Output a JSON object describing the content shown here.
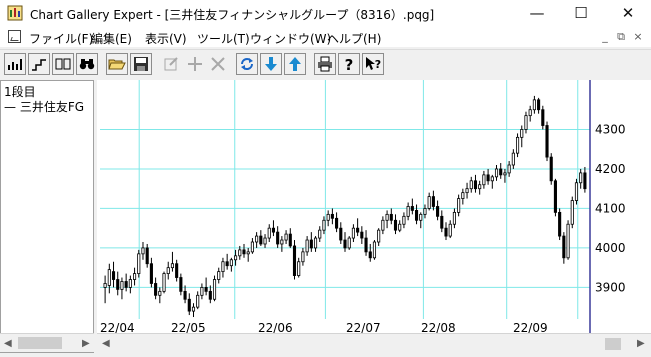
{
  "window": {
    "title": "Chart Gallery Expert - [三井住友フィナンシャルグループ（8316）.pqg]",
    "min_glyph": "—",
    "max_glyph": "☐",
    "close_glyph": "✕"
  },
  "menu": {
    "file": "ファイル(F)",
    "edit": "編集(E)",
    "view": "表示(V)",
    "tool": "ツール(T)",
    "window": "ウィンドウ(W)",
    "help": "ヘルプ(H)",
    "mdi_min": "_",
    "mdi_restore": "⧉",
    "mdi_close": "×"
  },
  "toolbar_icons": [
    "chart-type-icon",
    "step-chart-icon",
    "two-pane-icon",
    "binoculars-icon",
    "open-folder-icon",
    "save-disk-icon",
    "edit-disabled-icon",
    "add-disabled-icon",
    "delete-disabled-icon",
    "refresh-icon",
    "download-icon",
    "upload-icon",
    "print-icon",
    "help-icon",
    "context-help-icon"
  ],
  "left_pane": {
    "heading": "1段目",
    "series_label": "— 三井住友FG"
  },
  "colors": {
    "grid": "#7fe8e8",
    "axis": "#3a3a9a",
    "candle": "#000000"
  },
  "chart_data": {
    "type": "candlestick",
    "x_tick_labels": [
      "22/04",
      "22/05",
      "22/06",
      "22/07",
      "22/08",
      "22/09"
    ],
    "y_ticks": [
      3900,
      4000,
      4100,
      4200,
      4300
    ],
    "ylim": [
      3820,
      4405
    ],
    "ohlc": [
      [
        3900,
        3930,
        3860,
        3910
      ],
      [
        3905,
        3960,
        3885,
        3945
      ],
      [
        3940,
        3965,
        3900,
        3920
      ],
      [
        3920,
        3940,
        3880,
        3895
      ],
      [
        3895,
        3925,
        3870,
        3915
      ],
      [
        3915,
        3935,
        3890,
        3900
      ],
      [
        3900,
        3930,
        3885,
        3920
      ],
      [
        3920,
        3950,
        3905,
        3935
      ],
      [
        3935,
        3995,
        3925,
        3985
      ],
      [
        3985,
        4015,
        3970,
        4000
      ],
      [
        4000,
        4010,
        3950,
        3960
      ],
      [
        3960,
        3975,
        3900,
        3910
      ],
      [
        3910,
        3925,
        3870,
        3880
      ],
      [
        3880,
        3900,
        3860,
        3890
      ],
      [
        3890,
        3940,
        3885,
        3935
      ],
      [
        3935,
        3965,
        3920,
        3950
      ],
      [
        3950,
        3990,
        3940,
        3960
      ],
      [
        3960,
        3970,
        3915,
        3925
      ],
      [
        3925,
        3935,
        3880,
        3890
      ],
      [
        3890,
        3905,
        3860,
        3870
      ],
      [
        3870,
        3885,
        3830,
        3840
      ],
      [
        3840,
        3860,
        3825,
        3850
      ],
      [
        3850,
        3890,
        3845,
        3880
      ],
      [
        3880,
        3910,
        3870,
        3900
      ],
      [
        3900,
        3925,
        3880,
        3890
      ],
      [
        3890,
        3905,
        3860,
        3870
      ],
      [
        3870,
        3930,
        3865,
        3920
      ],
      [
        3920,
        3950,
        3910,
        3940
      ],
      [
        3940,
        3975,
        3925,
        3965
      ],
      [
        3965,
        3985,
        3945,
        3955
      ],
      [
        3955,
        3975,
        3940,
        3970
      ],
      [
        3970,
        3995,
        3955,
        3980
      ],
      [
        3980,
        4005,
        3970,
        3995
      ],
      [
        3995,
        4010,
        3975,
        3985
      ],
      [
        3985,
        4000,
        3965,
        3990
      ],
      [
        3990,
        4025,
        3985,
        4015
      ],
      [
        4015,
        4040,
        4000,
        4030
      ],
      [
        4030,
        4045,
        4005,
        4010
      ],
      [
        4010,
        4035,
        4000,
        4025
      ],
      [
        4025,
        4060,
        4015,
        4050
      ],
      [
        4050,
        4070,
        4030,
        4040
      ],
      [
        4040,
        4055,
        4000,
        4010
      ],
      [
        4010,
        4030,
        3990,
        4020
      ],
      [
        4020,
        4045,
        4010,
        4035
      ],
      [
        4035,
        4050,
        4000,
        4005
      ],
      [
        4005,
        4020,
        3920,
        3930
      ],
      [
        3930,
        3975,
        3925,
        3965
      ],
      [
        3965,
        4000,
        3955,
        3990
      ],
      [
        3990,
        4030,
        3980,
        4020
      ],
      [
        4020,
        4040,
        3990,
        4000
      ],
      [
        4000,
        4030,
        3990,
        4025
      ],
      [
        4025,
        4055,
        4015,
        4045
      ],
      [
        4045,
        4080,
        4035,
        4070
      ],
      [
        4070,
        4095,
        4055,
        4085
      ],
      [
        4085,
        4100,
        4060,
        4075
      ],
      [
        4075,
        4090,
        4040,
        4050
      ],
      [
        4050,
        4065,
        4010,
        4020
      ],
      [
        4020,
        4040,
        3990,
        4000
      ],
      [
        4000,
        4030,
        3995,
        4025
      ],
      [
        4025,
        4060,
        4015,
        4050
      ],
      [
        4050,
        4075,
        4030,
        4040
      ],
      [
        4040,
        4055,
        4010,
        4025
      ],
      [
        4025,
        4045,
        3980,
        3990
      ],
      [
        3990,
        4010,
        3965,
        3975
      ],
      [
        3975,
        4020,
        3970,
        4015
      ],
      [
        4015,
        4050,
        4005,
        4045
      ],
      [
        4045,
        4080,
        4035,
        4070
      ],
      [
        4070,
        4095,
        4050,
        4085
      ],
      [
        4085,
        4100,
        4060,
        4070
      ],
      [
        4070,
        4085,
        4035,
        4045
      ],
      [
        4045,
        4070,
        4040,
        4060
      ],
      [
        4060,
        4090,
        4050,
        4080
      ],
      [
        4080,
        4115,
        4070,
        4105
      ],
      [
        4105,
        4125,
        4085,
        4095
      ],
      [
        4095,
        4110,
        4060,
        4070
      ],
      [
        4070,
        4090,
        4050,
        4085
      ],
      [
        4085,
        4110,
        4075,
        4100
      ],
      [
        4100,
        4140,
        4095,
        4130
      ],
      [
        4130,
        4145,
        4095,
        4105
      ],
      [
        4105,
        4120,
        4070,
        4080
      ],
      [
        4080,
        4095,
        4040,
        4050
      ],
      [
        4050,
        4065,
        4020,
        4030
      ],
      [
        4030,
        4070,
        4025,
        4060
      ],
      [
        4060,
        4100,
        4050,
        4090
      ],
      [
        4090,
        4135,
        4080,
        4125
      ],
      [
        4125,
        4150,
        4110,
        4140
      ],
      [
        4140,
        4165,
        4125,
        4150
      ],
      [
        4150,
        4180,
        4140,
        4170
      ],
      [
        4170,
        4185,
        4140,
        4150
      ],
      [
        4150,
        4170,
        4135,
        4160
      ],
      [
        4160,
        4195,
        4150,
        4185
      ],
      [
        4185,
        4200,
        4160,
        4170
      ],
      [
        4170,
        4185,
        4150,
        4180
      ],
      [
        4180,
        4210,
        4170,
        4200
      ],
      [
        4200,
        4215,
        4175,
        4185
      ],
      [
        4185,
        4200,
        4165,
        4190
      ],
      [
        4190,
        4220,
        4180,
        4210
      ],
      [
        4210,
        4250,
        4200,
        4240
      ],
      [
        4240,
        4290,
        4230,
        4280
      ],
      [
        4280,
        4310,
        4255,
        4300
      ],
      [
        4300,
        4345,
        4290,
        4335
      ],
      [
        4335,
        4360,
        4320,
        4350
      ],
      [
        4350,
        4385,
        4340,
        4375
      ],
      [
        4375,
        4380,
        4340,
        4350
      ],
      [
        4350,
        4360,
        4300,
        4310
      ],
      [
        4310,
        4320,
        4220,
        4230
      ],
      [
        4230,
        4240,
        4160,
        4170
      ],
      [
        4170,
        4175,
        4080,
        4090
      ],
      [
        4090,
        4100,
        4020,
        4030
      ],
      [
        4030,
        4040,
        3960,
        3975
      ],
      [
        3975,
        4070,
        3970,
        4060
      ],
      [
        4060,
        4130,
        4050,
        4120
      ],
      [
        4120,
        4175,
        4110,
        4165
      ],
      [
        4165,
        4200,
        4150,
        4190
      ],
      [
        4190,
        4205,
        4140,
        4150
      ]
    ]
  }
}
